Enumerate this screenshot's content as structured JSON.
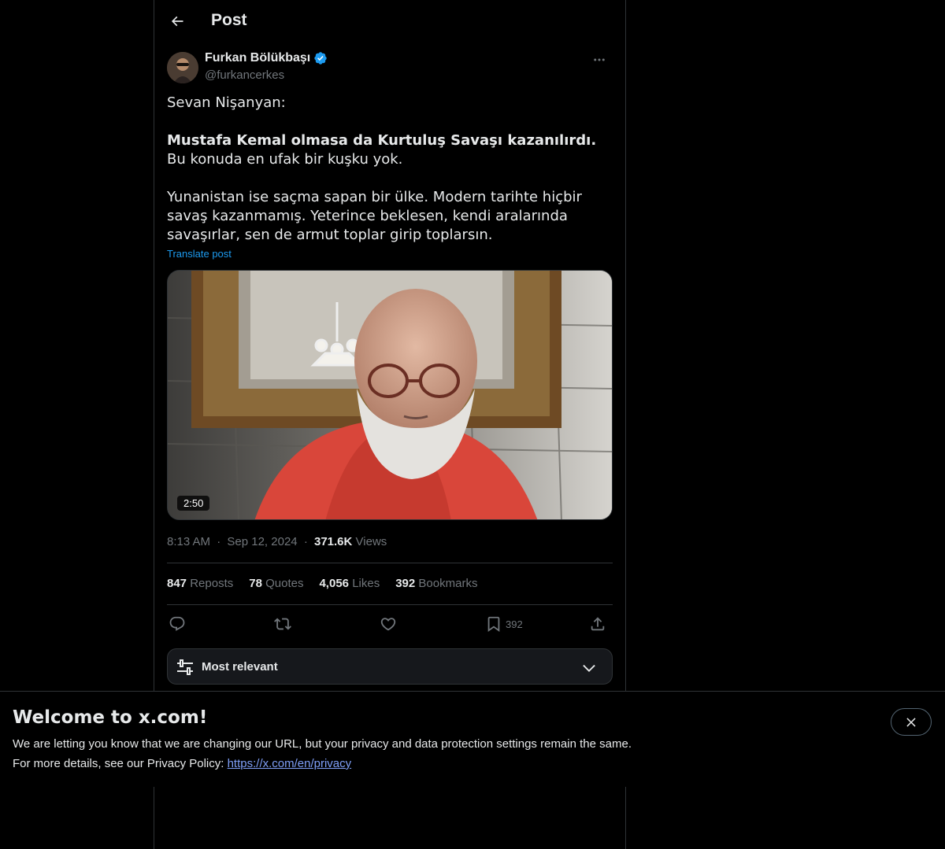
{
  "header": {
    "title": "Post",
    "back_icon": "arrow-left-icon"
  },
  "author": {
    "name": "Furkan Bölükbaşı",
    "handle": "@furkancerkes",
    "verified": true,
    "verified_color": "#1d9bf0"
  },
  "post": {
    "line1": "Sevan Nişanyan:",
    "bold_text": "Mustafa Kemal olmasa da Kurtuluş Savaşı kazanılırdı.",
    "rest_text": " Bu konuda en ufak bir kuşku yok.",
    "paragraph3": "Yunanistan ise saçma sapan bir ülke. Modern tarihte hiçbir savaş kazanmamış. Yeterince beklesen, kendi aralarında savaşırlar, sen de armut toplar girip toplarsın.",
    "translate_label": "Translate post",
    "video_duration": "2:50"
  },
  "meta": {
    "time": "8:13 AM",
    "separator": "·",
    "date": "Sep 12, 2024",
    "views_count": "371.6K",
    "views_label": "Views"
  },
  "stats": {
    "reposts_count": "847",
    "reposts_label": "Reposts",
    "quotes_count": "78",
    "quotes_label": "Quotes",
    "likes_count": "4,056",
    "likes_label": "Likes",
    "bookmarks_count": "392",
    "bookmarks_label": "Bookmarks"
  },
  "actions": {
    "reply_icon": "reply-icon",
    "repost_icon": "repost-icon",
    "like_icon": "heart-icon",
    "bookmark_icon": "bookmark-icon",
    "bookmark_count": "392",
    "share_icon": "share-icon"
  },
  "sort": {
    "label": "Most relevant"
  },
  "banner": {
    "title": "Welcome to x.com!",
    "line1": "We are letting you know that we are changing our URL, but your privacy and data protection settings remain the same.",
    "line2_prefix": "For more details, see our Privacy Policy: ",
    "link": "https://x.com/en/privacy"
  },
  "colors": {
    "accent": "#1d9bf0",
    "text_primary": "#e7e9ea",
    "text_secondary": "#71767b",
    "border": "#2f3336"
  }
}
